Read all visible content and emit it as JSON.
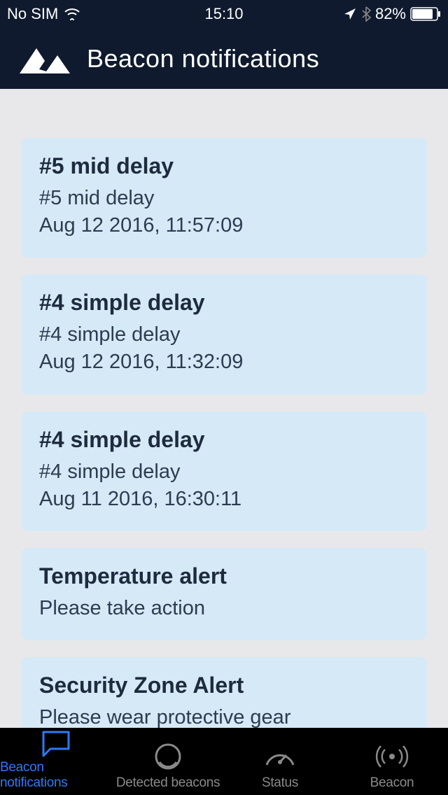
{
  "status": {
    "carrier": "No SIM",
    "time": "15:10",
    "battery_percent": "82%"
  },
  "header": {
    "title": "Beacon notifications"
  },
  "notifications": [
    {
      "title": "#5 mid delay",
      "body": "#5 mid delay",
      "timestamp": "Aug 12 2016, 11:57:09"
    },
    {
      "title": "#4 simple delay",
      "body": "#4 simple delay",
      "timestamp": "Aug 12 2016, 11:32:09"
    },
    {
      "title": "#4 simple delay",
      "body": "#4 simple delay",
      "timestamp": "Aug 11 2016, 16:30:11"
    },
    {
      "title": "Temperature alert",
      "body": "Please take action",
      "timestamp": ""
    },
    {
      "title": "Security Zone Alert",
      "body": "Please wear protective gear",
      "timestamp": ""
    }
  ],
  "tabs": [
    {
      "label": "Beacon notifications",
      "icon": "chat-icon",
      "active": true
    },
    {
      "label": "Detected beacons",
      "icon": "circle-icon",
      "active": false
    },
    {
      "label": "Status",
      "icon": "gauge-icon",
      "active": false
    },
    {
      "label": "Beacon",
      "icon": "broadcast-icon",
      "active": false
    }
  ]
}
